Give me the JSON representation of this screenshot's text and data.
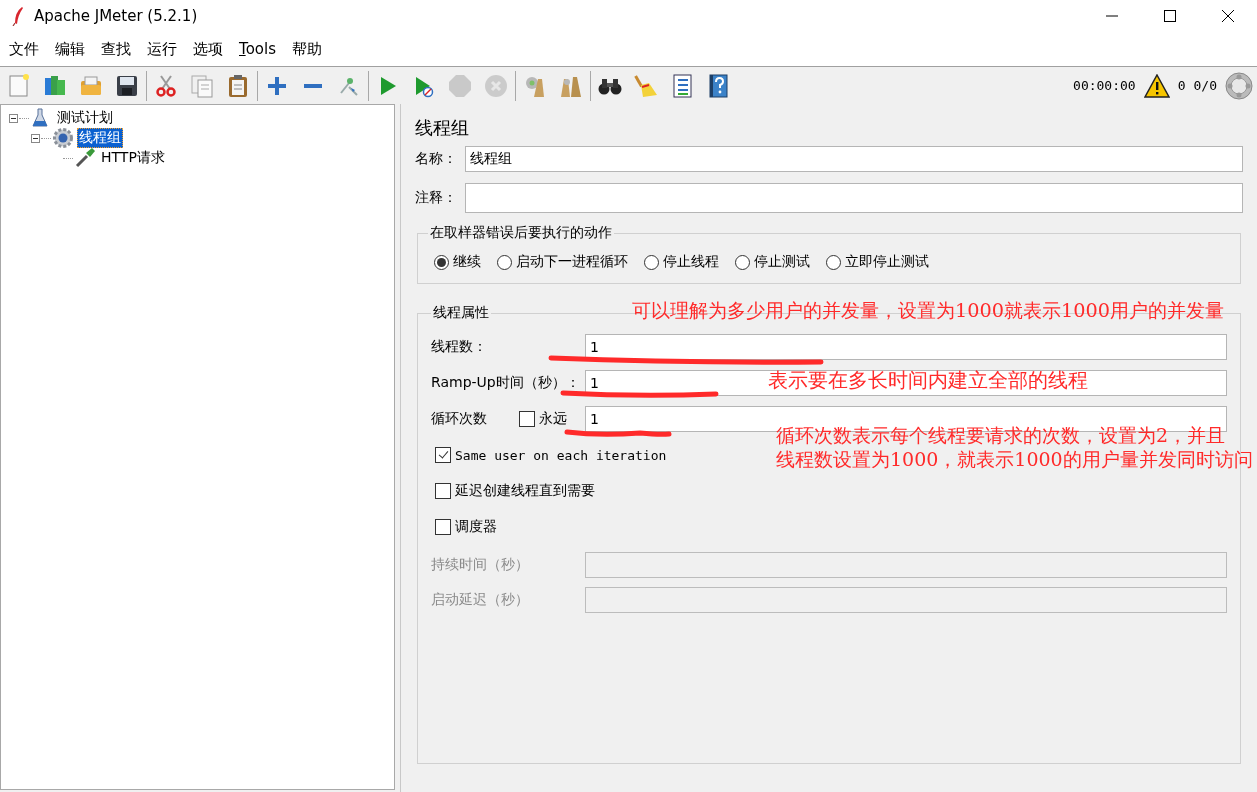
{
  "window": {
    "title": "Apache JMeter (5.2.1)"
  },
  "menu": [
    {
      "label": "文件",
      "underline_first": false
    },
    {
      "label": "编辑",
      "underline_first": false
    },
    {
      "label": "查找",
      "underline_first": false
    },
    {
      "label": "运行",
      "underline_first": false
    },
    {
      "label": "选项",
      "underline_first": false
    },
    {
      "label": "Tools",
      "underline_first": true
    },
    {
      "label": "帮助",
      "underline_first": false
    }
  ],
  "toolbar": [
    [
      {
        "kind": "new",
        "disabled": false
      },
      {
        "kind": "templates",
        "disabled": false
      },
      {
        "kind": "open",
        "disabled": false
      },
      {
        "kind": "save",
        "disabled": false
      }
    ],
    [
      {
        "kind": "cut",
        "disabled": false
      },
      {
        "kind": "copy",
        "disabled": false
      },
      {
        "kind": "paste",
        "disabled": false
      }
    ],
    [
      {
        "kind": "expand",
        "disabled": false
      },
      {
        "kind": "collapse",
        "disabled": false
      },
      {
        "kind": "toggle",
        "disabled": false
      }
    ],
    [
      {
        "kind": "start",
        "disabled": false
      },
      {
        "kind": "start-no-pause",
        "disabled": false
      },
      {
        "kind": "stop",
        "disabled": true
      },
      {
        "kind": "shutdown",
        "disabled": true
      }
    ],
    [
      {
        "kind": "clear",
        "disabled": false
      },
      {
        "kind": "clear-all",
        "disabled": false
      }
    ],
    [
      {
        "kind": "search",
        "disabled": false
      },
      {
        "kind": "reset-search",
        "disabled": false
      },
      {
        "kind": "functions",
        "disabled": false
      },
      {
        "kind": "help",
        "disabled": false
      }
    ]
  ],
  "status": {
    "timer": "00:00:00",
    "warnings": "0",
    "threads": "0/0"
  },
  "tree": [
    {
      "label": "测试计划",
      "kind": "plan",
      "expanded": true,
      "selected": false,
      "children": [
        {
          "label": "线程组",
          "kind": "thread-group",
          "expanded": true,
          "selected": true,
          "children": [
            {
              "label": "HTTP请求",
              "kind": "sampler",
              "selected": false
            }
          ]
        }
      ]
    }
  ],
  "panel": {
    "title": "线程组",
    "name": {
      "label": "名称：",
      "value": "线程组"
    },
    "comment": {
      "label": "注释："
    },
    "on_error": {
      "legend": "在取样器错误后要执行的动作",
      "options": [
        {
          "label": "继续",
          "selected": true
        },
        {
          "label": "启动下一进程循环",
          "selected": false
        },
        {
          "label": "停止线程",
          "selected": false
        },
        {
          "label": "停止测试",
          "selected": false
        },
        {
          "label": "立即停止测试",
          "selected": false
        }
      ]
    },
    "thread_properties": {
      "legend": "线程属性",
      "threads": {
        "label": "线程数：",
        "value": "1"
      },
      "ramp_up": {
        "label": "Ramp-Up时间（秒）：",
        "value": "1"
      },
      "loops": {
        "label": "循环次数",
        "forever": {
          "label": "永远",
          "checked": false
        },
        "value": "1"
      },
      "options": [
        {
          "label": "Same user on each iteration",
          "kind": "mono",
          "checked": true
        },
        {
          "label": "延迟创建线程直到需要",
          "kind": "plain",
          "checked": false
        },
        {
          "label": "调度器",
          "kind": "plain",
          "checked": false
        }
      ],
      "scheduler_fields": [
        {
          "label": "持续时间（秒）",
          "disabled": true
        },
        {
          "label": "启动延迟（秒）",
          "disabled": true
        }
      ]
    }
  },
  "annotations": [
    {
      "text": "可以理解为多少用户的并发量，设置为1000就表示1000用户的并发量"
    },
    {
      "text": "表示要在多长时间内建立全部的线程"
    },
    {
      "text": "循环次数表示每个线程要请求的次数，设置为2，并且"
    },
    {
      "text": "线程数设置为1000，就表示1000的用户量并发同时访问"
    }
  ]
}
